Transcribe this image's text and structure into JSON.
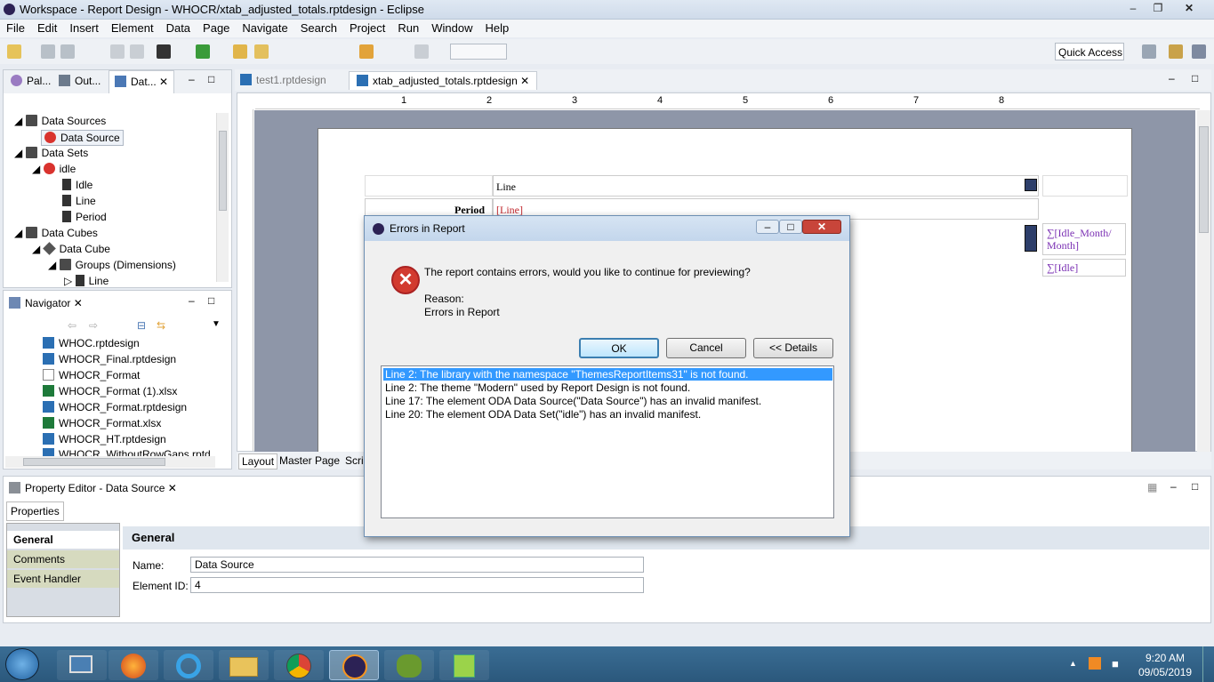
{
  "window": {
    "title": "Workspace - Report Design - WHOCR/xtab_adjusted_totals.rptdesign - Eclipse"
  },
  "menu": [
    "File",
    "Edit",
    "Insert",
    "Element",
    "Data",
    "Page",
    "Navigate",
    "Search",
    "Project",
    "Run",
    "Window",
    "Help"
  ],
  "toolbar": {
    "quick_access": "Quick Access"
  },
  "left_tabs": [
    "Pal...",
    "Out...",
    "Dat..."
  ],
  "data_tree": {
    "data_sources": "Data Sources",
    "data_source": "Data Source",
    "data_sets": "Data Sets",
    "idle": "idle",
    "col_idle": "Idle",
    "col_line": "Line",
    "col_period": "Period",
    "data_cubes": "Data Cubes",
    "data_cube": "Data Cube",
    "groups": "Groups (Dimensions)",
    "group_line": "Line"
  },
  "navigator": {
    "title": "Navigator",
    "files": [
      "WHOC.rptdesign",
      "WHOCR_Final.rptdesign",
      "WHOCR_Format",
      "WHOCR_Format (1).xlsx",
      "WHOCR_Format.rptdesign",
      "WHOCR_Format.xlsx",
      "WHOCR_HT.rptdesign",
      "WHOCR_WithoutRowGaps.rptd..."
    ]
  },
  "editor_tabs": {
    "tab1": "test1.rptdesign",
    "tab2": "xtab_adjusted_totals.rptdesign"
  },
  "ruler_marks": [
    "1",
    "2",
    "3",
    "4",
    "5",
    "6",
    "7",
    "8"
  ],
  "report": {
    "line_header": "Line",
    "period_label": "Period",
    "line_field": "[Line]",
    "idle_month": "∑[Idle_Month/ Month]",
    "idle_sum": "∑[Idle]"
  },
  "bottom_tabs": [
    "Layout",
    "Master Page",
    "Scri"
  ],
  "dialog": {
    "title": "Errors in Report",
    "message": "The report contains errors, would you like to continue for previewing?",
    "reason_label": "Reason:",
    "reason": "Errors in Report",
    "ok": "OK",
    "cancel": "Cancel",
    "details": "<< Details",
    "errors": [
      "Line 2: The library with the namespace \"ThemesReportItems31\" is not found.",
      "Line 2: The theme \"Modern\" used by Report Design is not found.",
      "Line 17: The element ODA Data Source(\"Data Source\") has an invalid manifest.",
      "Line 20: The element ODA Data Set(\"idle\") has an invalid manifest."
    ]
  },
  "property_editor": {
    "title": "Property Editor - Data Source",
    "tab": "Properties",
    "categories": [
      "General",
      "Comments",
      "Event Handler"
    ],
    "section": "General",
    "name_label": "Name:",
    "name_value": "Data Source",
    "id_label": "Element ID:",
    "id_value": "4"
  },
  "clock": {
    "time": "9:20 AM",
    "date": "09/05/2019"
  }
}
